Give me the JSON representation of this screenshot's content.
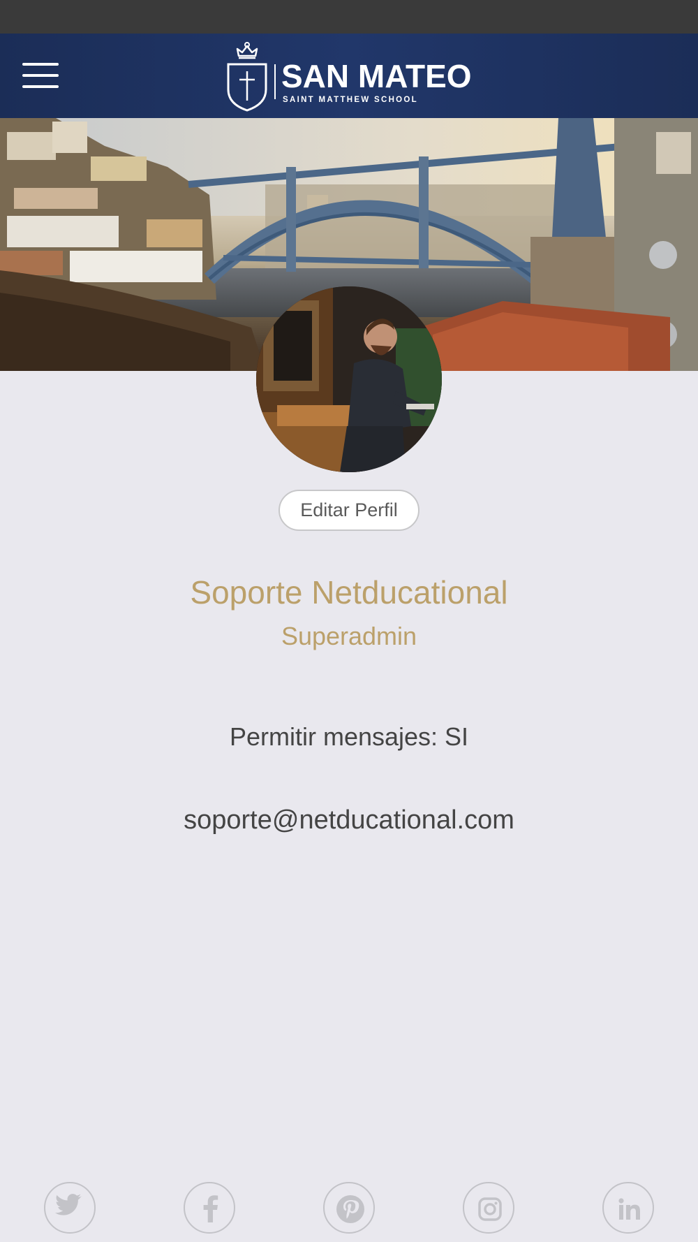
{
  "header": {
    "menu_icon": "hamburger-menu-icon",
    "logo": {
      "title": "SAN MATEO",
      "subtitle": "SAINT MATTHEW SCHOOL",
      "icon": "crowned-shield-cross-icon"
    }
  },
  "profile": {
    "edit_button_label": "Editar Perfil",
    "name": "Soporte Netducational",
    "role": "Superadmin",
    "allow_messages": "Permitir mensajes: SI",
    "email": "soporte@netducational.com"
  },
  "footer": {
    "social_icons": [
      "twitter-icon",
      "facebook-icon",
      "pinterest-icon",
      "instagram-icon",
      "linkedin-icon"
    ]
  },
  "colors": {
    "header_navy": "#1b2d57",
    "accent_gold": "#bba06a",
    "background": "#e9e8ee",
    "text_dark": "#444444",
    "social_gray": "#c3c3c8"
  }
}
